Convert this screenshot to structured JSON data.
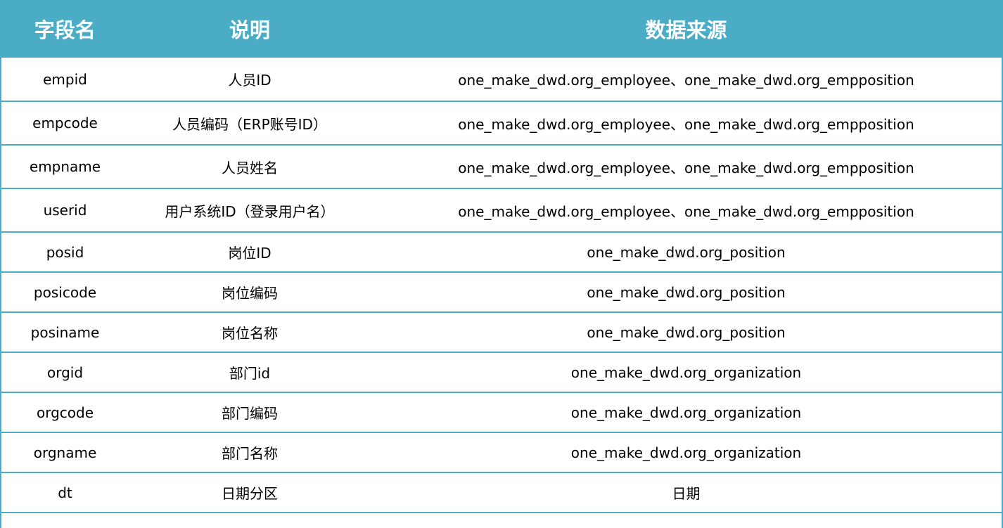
{
  "colors": {
    "header_bg": "#4BACC6",
    "header_text": "#FFFFFF",
    "border": "#4BACC6"
  },
  "table": {
    "headers": [
      "字段名",
      "说明",
      "数据来源"
    ],
    "rows": [
      [
        "empid",
        "人员ID",
        "one_make_dwd.org_employee、one_make_dwd.org_empposition"
      ],
      [
        "empcode",
        "人员编码（ERP账号ID）",
        "one_make_dwd.org_employee、one_make_dwd.org_empposition"
      ],
      [
        "empname",
        "人员姓名",
        "one_make_dwd.org_employee、one_make_dwd.org_empposition"
      ],
      [
        "userid",
        "用户系统ID（登录用户名）",
        "one_make_dwd.org_employee、one_make_dwd.org_empposition"
      ],
      [
        "posid",
        "岗位ID",
        "one_make_dwd.org_position"
      ],
      [
        "posicode",
        "岗位编码",
        "one_make_dwd.org_position"
      ],
      [
        "posiname",
        "岗位名称",
        "one_make_dwd.org_position"
      ],
      [
        "orgid",
        "部门id",
        "one_make_dwd.org_organization"
      ],
      [
        "orgcode",
        "部门编码",
        "one_make_dwd.org_organization"
      ],
      [
        "orgname",
        "部门名称",
        "one_make_dwd.org_organization"
      ],
      [
        "dt",
        "日期分区",
        "日期"
      ]
    ]
  }
}
